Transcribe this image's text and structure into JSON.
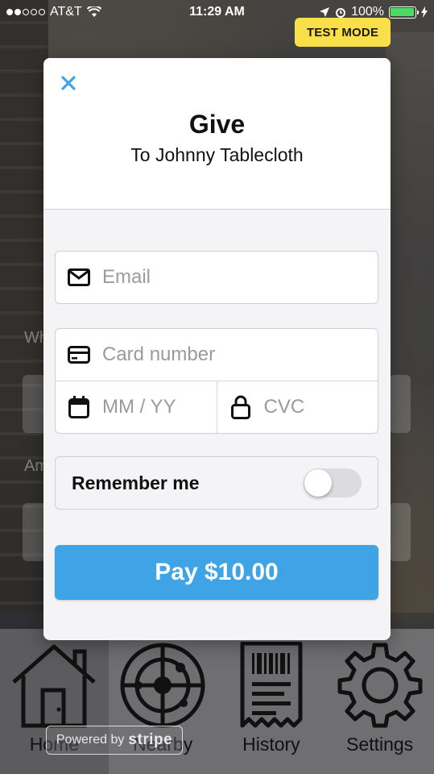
{
  "status_bar": {
    "carrier": "AT&T",
    "time": "11:29 AM",
    "battery": "100%",
    "battery_color": "#4cd964"
  },
  "test_mode_badge": "TEST MODE",
  "background_labels": [
    "Wh",
    "Am"
  ],
  "modal": {
    "title": "Give",
    "subtitle": "To Johnny Tablecloth",
    "close_icon": "close-icon",
    "email_placeholder": "Email",
    "card_number_placeholder": "Card number",
    "expiry_placeholder": "MM / YY",
    "cvc_placeholder": "CVC",
    "remember_label": "Remember me",
    "remember_on": false,
    "pay_label": "Pay $10.00",
    "pay_color": "#3ea4e6"
  },
  "powered_by": {
    "prefix": "Powered by",
    "brand": "stripe"
  },
  "tabs": [
    {
      "label": "Home",
      "icon": "home-icon"
    },
    {
      "label": "Nearby",
      "icon": "radar-icon"
    },
    {
      "label": "History",
      "icon": "receipt-icon"
    },
    {
      "label": "Settings",
      "icon": "gear-icon"
    }
  ]
}
